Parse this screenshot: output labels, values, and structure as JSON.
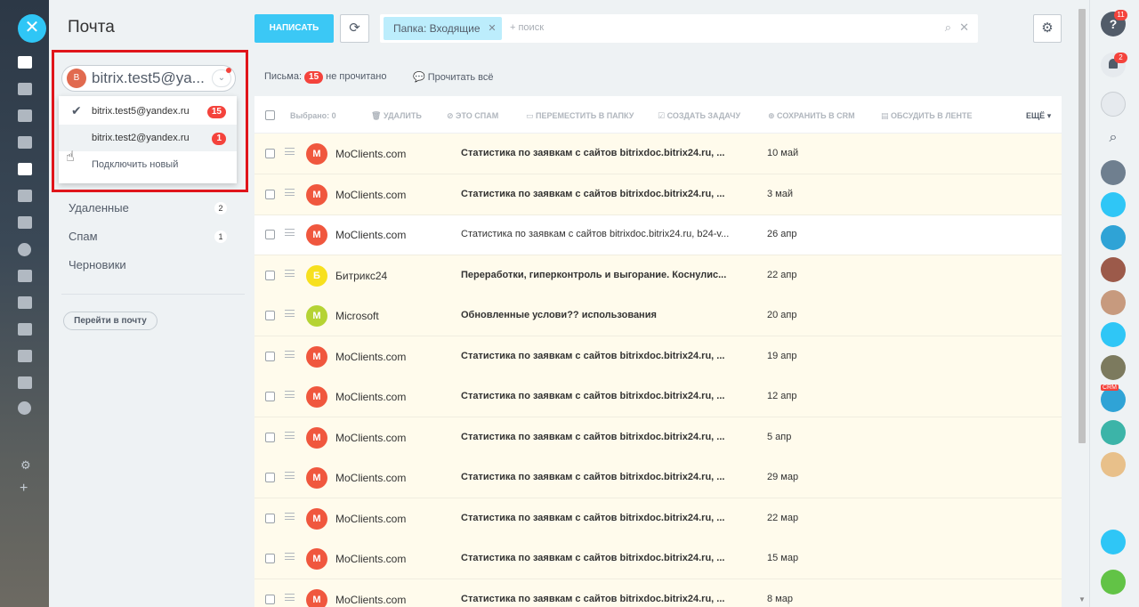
{
  "app": {
    "close_symbol": "✕"
  },
  "sidebar": {
    "title": "Почта",
    "mailbox": {
      "avatar_letter": "B",
      "name": "bitrix.test5@ya...",
      "chevron": "⌄"
    },
    "dropdown": [
      {
        "label": "bitrix.test5@yandex.ru",
        "count": "15",
        "checked": true
      },
      {
        "label": "bitrix.test2@yandex.ru",
        "count": "1",
        "checked": false
      },
      {
        "label": "Подключить новый",
        "count": null,
        "checked": false
      }
    ],
    "folders": [
      {
        "label": "Удаленные",
        "count": "2"
      },
      {
        "label": "Спам",
        "count": "1"
      },
      {
        "label": "Черновики",
        "count": null
      }
    ],
    "goto_label": "Перейти в почту"
  },
  "header": {
    "compose_label": "НАПИСАТЬ",
    "refresh_symbol": "⟳",
    "filter_chip": "Папка: Входящие",
    "search_placeholder": "+ поиск",
    "settings_symbol": "⚙"
  },
  "stats": {
    "prefix": "Письма:",
    "unread_count": "15",
    "suffix": "не прочитано",
    "mark_all": "Прочитать всё"
  },
  "toolbar": {
    "selected": "Выбрано: 0",
    "delete": "УДАЛИТЬ",
    "spam": "ЭТО СПАМ",
    "move": "ПЕРЕМЕСТИТЬ В ПАПКУ",
    "task": "СОЗДАТЬ ЗАДАЧУ",
    "crm": "СОХРАНИТЬ В CRM",
    "feed": "ОБСУДИТЬ В ЛЕНТЕ",
    "more": "ЕЩЁ"
  },
  "messages": [
    {
      "avatar": "M",
      "color": "#f0573e",
      "from": "MoClients.com",
      "subject": "Статистика по заявкам с сайтов bitrixdoc.bitrix24.ru, ...",
      "date": "10 май",
      "unread": true
    },
    {
      "avatar": "M",
      "color": "#f0573e",
      "from": "MoClients.com",
      "subject": "Статистика по заявкам с сайтов bitrixdoc.bitrix24.ru, ...",
      "date": "3 май",
      "unread": true
    },
    {
      "avatar": "M",
      "color": "#f0573e",
      "from": "MoClients.com",
      "subject": "Статистика по заявкам с сайтов bitrixdoc.bitrix24.ru, b24-v...",
      "date": "26 апр",
      "unread": false
    },
    {
      "avatar": "Б",
      "color": "#f7e01e",
      "from": "Битрикс24",
      "subject": "Переработки, гиперконтроль и выгорание. Коснулис...",
      "date": "22 апр",
      "unread": true
    },
    {
      "avatar": "M",
      "color": "#b5d334",
      "from": "Microsoft",
      "subject": "Обновленные услови?? использования",
      "date": "20 апр",
      "unread": true
    },
    {
      "avatar": "M",
      "color": "#f0573e",
      "from": "MoClients.com",
      "subject": "Статистика по заявкам с сайтов bitrixdoc.bitrix24.ru, ...",
      "date": "19 апр",
      "unread": true
    },
    {
      "avatar": "M",
      "color": "#f0573e",
      "from": "MoClients.com",
      "subject": "Статистика по заявкам с сайтов bitrixdoc.bitrix24.ru, ...",
      "date": "12 апр",
      "unread": true
    },
    {
      "avatar": "M",
      "color": "#f0573e",
      "from": "MoClients.com",
      "subject": "Статистика по заявкам с сайтов bitrixdoc.bitrix24.ru, ...",
      "date": "5 апр",
      "unread": true
    },
    {
      "avatar": "M",
      "color": "#f0573e",
      "from": "MoClients.com",
      "subject": "Статистика по заявкам с сайтов bitrixdoc.bitrix24.ru, ...",
      "date": "29 мар",
      "unread": true
    },
    {
      "avatar": "M",
      "color": "#f0573e",
      "from": "MoClients.com",
      "subject": "Статистика по заявкам с сайтов bitrixdoc.bitrix24.ru, ...",
      "date": "22 мар",
      "unread": true
    },
    {
      "avatar": "M",
      "color": "#f0573e",
      "from": "MoClients.com",
      "subject": "Статистика по заявкам с сайтов bitrixdoc.bitrix24.ru, ...",
      "date": "15 мар",
      "unread": true
    },
    {
      "avatar": "M",
      "color": "#f0573e",
      "from": "MoClients.com",
      "subject": "Статистика по заявкам с сайтов bitrixdoc.bitrix24.ru, ...",
      "date": "8 мар",
      "unread": true
    }
  ],
  "rightbar": {
    "help_symbol": "?",
    "help_badge": "11",
    "bell_badge": "2",
    "search_symbol": "🔍",
    "crm_tag": "CRM"
  }
}
